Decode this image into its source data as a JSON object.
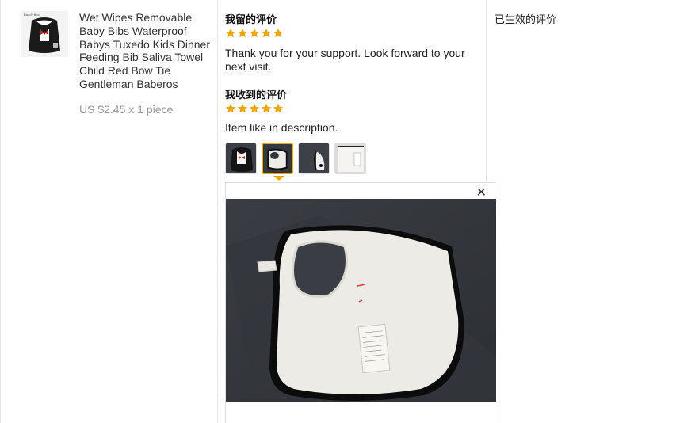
{
  "product": {
    "title": "Wet Wipes Removable Baby Bibs Waterproof Babys Tuxedo Kids Dinner Feeding Bib Saliva Towel Child Red Bow Tie Gentleman Baberos",
    "price": "US $2.45 x 1 piece",
    "thumb_caption": "Daddy Boo"
  },
  "feedback": {
    "left_heading": "我留的评价",
    "left_rating": 5,
    "left_text": "Thank you for your support. Look forward to your next visit.",
    "received_heading": "我收到的评价",
    "received_rating": 5,
    "received_text": "Item like in description.",
    "photos": [
      "photo-1",
      "photo-2",
      "photo-3",
      "photo-4"
    ],
    "active_photo": 2,
    "close_symbol": "✕"
  },
  "status": {
    "label": "已生效的评价"
  },
  "colors": {
    "star": "#f2a700",
    "active_border": "#f2a700",
    "divider": "#e6e6e6",
    "price": "#999999"
  },
  "icons": {
    "star": "star-icon",
    "close": "close-icon"
  }
}
